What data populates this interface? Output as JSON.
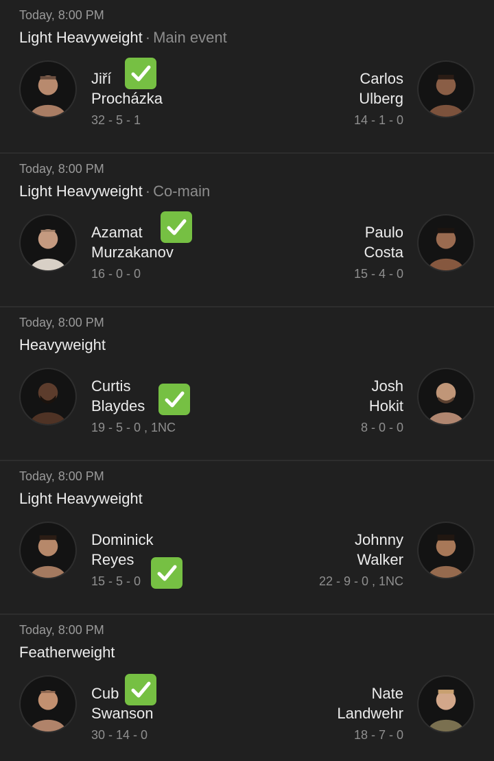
{
  "fights": [
    {
      "time": "Today, 8:00 PM",
      "division": "Light Heavyweight",
      "tag": "Main event",
      "left": {
        "first": "Jiří",
        "last": "Procházka",
        "record": "32 - 5 - 1",
        "winner": true
      },
      "right": {
        "first": "Carlos",
        "last": "Ulberg",
        "record": "14 - 1 - 0",
        "winner": false
      }
    },
    {
      "time": "Today, 8:00 PM",
      "division": "Light Heavyweight",
      "tag": "Co-main",
      "left": {
        "first": "Azamat",
        "last": "Murzakanov",
        "record": "16 - 0 - 0",
        "winner": true
      },
      "right": {
        "first": "Paulo",
        "last": "Costa",
        "record": "15 - 4 - 0",
        "winner": false
      }
    },
    {
      "time": "Today, 8:00 PM",
      "division": "Heavyweight",
      "tag": "",
      "left": {
        "first": "Curtis",
        "last": "Blaydes",
        "record": "19 - 5 - 0 , 1NC",
        "winner": true
      },
      "right": {
        "first": "Josh",
        "last": "Hokit",
        "record": "8 - 0 - 0",
        "winner": false
      }
    },
    {
      "time": "Today, 8:00 PM",
      "division": "Light Heavyweight",
      "tag": "",
      "left": {
        "first": "Dominick",
        "last": "Reyes",
        "record": "15 - 5 - 0",
        "winner": true
      },
      "right": {
        "first": "Johnny",
        "last": "Walker",
        "record": "22 - 9 - 0 , 1NC",
        "winner": false
      }
    },
    {
      "time": "Today, 8:00 PM",
      "division": "Featherweight",
      "tag": "",
      "left": {
        "first": "Cub",
        "last": "Swanson",
        "record": "30 - 14 - 0",
        "winner": true
      },
      "right": {
        "first": "Nate",
        "last": "Landwehr",
        "record": "18 - 7 - 0",
        "winner": false
      }
    }
  ],
  "icons": {
    "avatar": "fighter-avatar-icon",
    "check": "checkmark-icon"
  },
  "colors": {
    "check_bg": "#76c043",
    "background": "#1f1f1f"
  }
}
